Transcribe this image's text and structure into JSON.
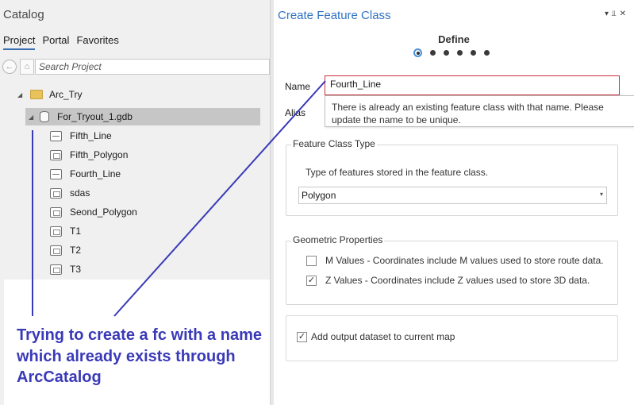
{
  "catalog": {
    "title": "Catalog",
    "tabs": [
      "Project",
      "Portal",
      "Favorites"
    ],
    "search_placeholder": "Search Project",
    "tree": {
      "folder": "Arc_Try",
      "gdb": "For_Tryout_1.gdb",
      "items": [
        {
          "name": "Fifth_Line",
          "icon": "line-feature-class-icon"
        },
        {
          "name": "Fifth_Polygon",
          "icon": "polygon-feature-class-icon"
        },
        {
          "name": "Fourth_Line",
          "icon": "line-feature-class-icon"
        },
        {
          "name": "sdas",
          "icon": "polygon-feature-class-icon"
        },
        {
          "name": "Seond_Polygon",
          "icon": "polygon-feature-class-icon"
        },
        {
          "name": "T1",
          "icon": "polygon-feature-class-icon"
        },
        {
          "name": "T2",
          "icon": "polygon-feature-class-icon"
        },
        {
          "name": "T3",
          "icon": "polygon-feature-class-icon"
        }
      ]
    }
  },
  "annotation": {
    "text": "Trying to create a fc with a name which already exists through ArcCatalog",
    "color": "#3a3ab8"
  },
  "create_fc": {
    "title": "Create Feature Class",
    "step_title": "Define",
    "steps_total": 6,
    "current_step": 1,
    "name_label": "Name",
    "name_value": "Fourth_Line",
    "alias_label": "Alias",
    "error_tooltip": "There is already an existing feature class with that name. Please update the name to be unique.",
    "feature_class_type": {
      "legend": "Feature Class Type",
      "description": "Type of features stored in the feature class.",
      "selected": "Polygon"
    },
    "geometric_properties": {
      "legend": "Geometric Properties",
      "m_values": {
        "label": "M Values - Coordinates include M values used to store route data.",
        "checked": false
      },
      "z_values": {
        "label": "Z Values - Coordinates include Z values used to store 3D data.",
        "checked": true
      }
    },
    "add_output": {
      "label": "Add output dataset to current map",
      "checked": true
    }
  },
  "colors": {
    "accent_title": "#2f72c4",
    "error_border": "#c8323c",
    "annotation": "#3a3ab8"
  }
}
